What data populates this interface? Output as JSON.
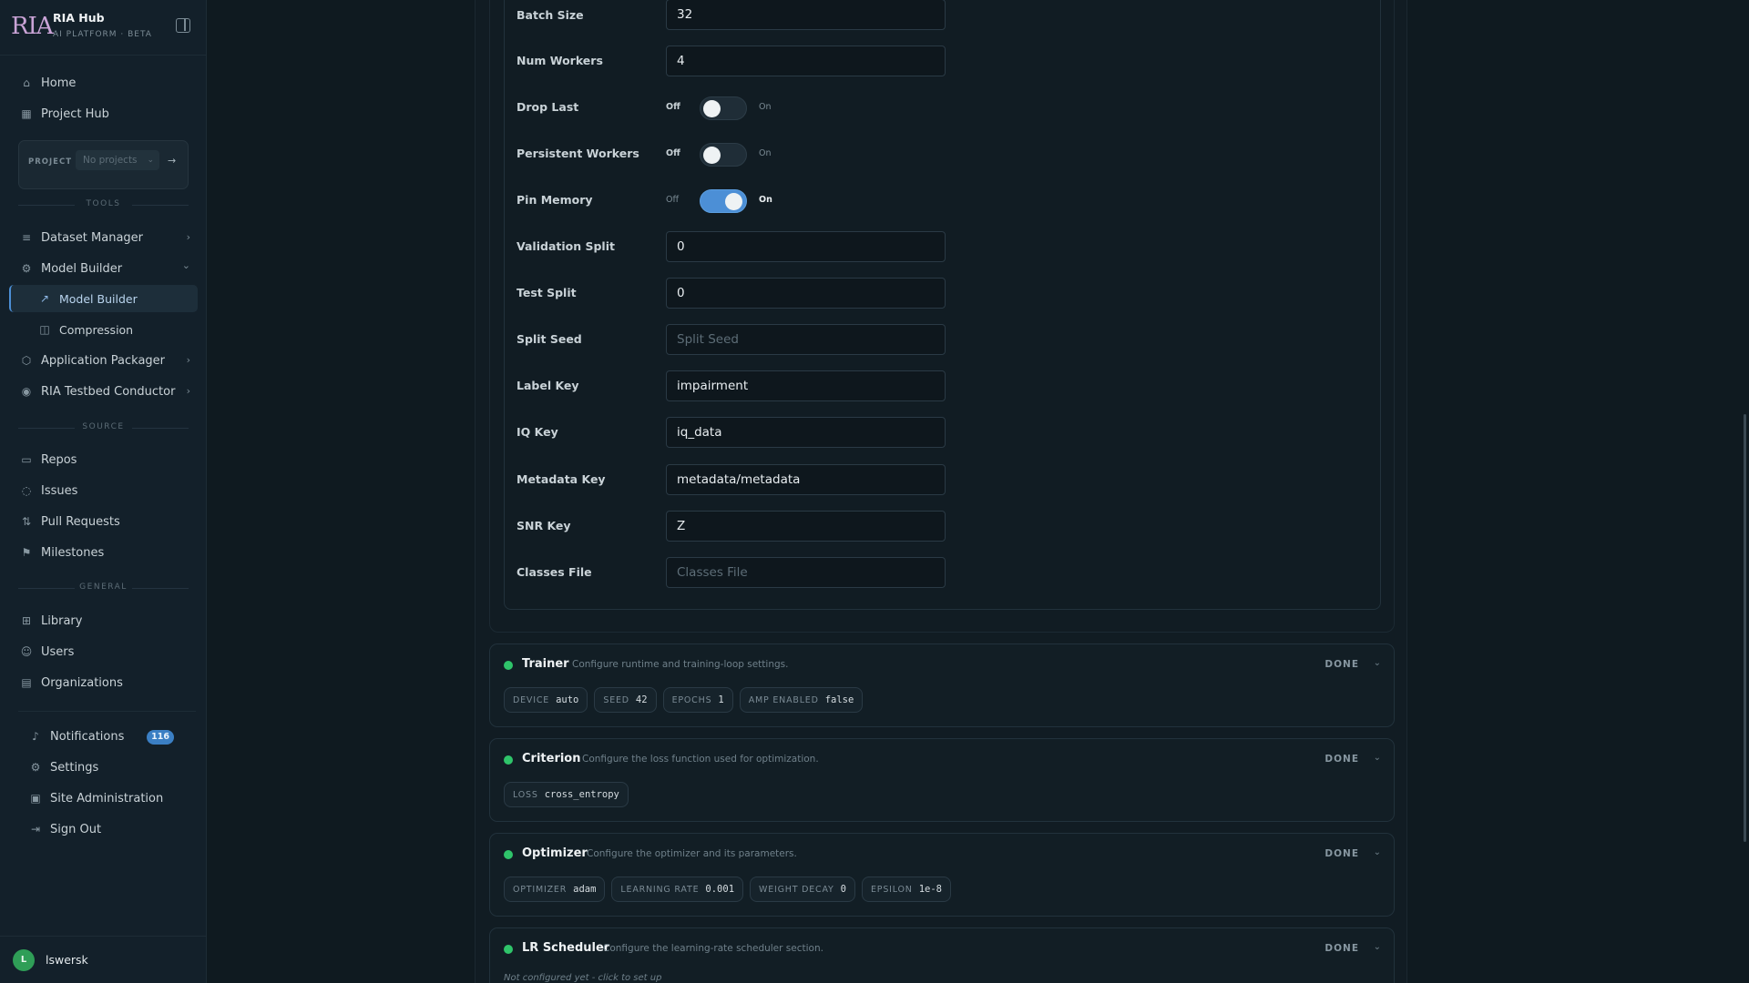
{
  "brand": {
    "logo": "RIA",
    "title": "RIA Hub",
    "subtitle": "AI PLATFORM · BETA"
  },
  "sidebar": {
    "top": [
      {
        "label": "Home",
        "icon": "home-icon"
      },
      {
        "label": "Project Hub",
        "icon": "board-icon"
      }
    ],
    "project": {
      "label": "PROJECT",
      "value": "No projects",
      "go": "→"
    },
    "sections": {
      "tools": "TOOLS",
      "source": "SOURCE",
      "general": "GENERAL"
    },
    "tools": [
      {
        "label": "Dataset Manager",
        "icon": "database-icon",
        "chevron": "›"
      },
      {
        "label": "Model Builder",
        "icon": "gear-icon",
        "chevron": "⌄"
      },
      {
        "label": "Model Builder",
        "icon": "chart-icon",
        "active": true
      },
      {
        "label": "Compression",
        "icon": "compress-icon"
      },
      {
        "label": "Application Packager",
        "icon": "package-icon",
        "chevron": "›"
      },
      {
        "label": "RIA Testbed Conductor",
        "icon": "antenna-icon",
        "chevron": "›"
      }
    ],
    "source": [
      {
        "label": "Repos",
        "icon": "repo-icon"
      },
      {
        "label": "Issues",
        "icon": "issue-icon"
      },
      {
        "label": "Pull Requests",
        "icon": "pull-request-icon"
      },
      {
        "label": "Milestones",
        "icon": "milestone-icon"
      }
    ],
    "general": [
      {
        "label": "Library",
        "icon": "grid-icon"
      },
      {
        "label": "Users",
        "icon": "user-icon"
      },
      {
        "label": "Organizations",
        "icon": "building-icon"
      }
    ],
    "bottom": [
      {
        "label": "Notifications",
        "icon": "bell-icon",
        "badge": "116"
      },
      {
        "label": "Settings",
        "icon": "settings-icon"
      },
      {
        "label": "Site Administration",
        "icon": "admin-icon"
      },
      {
        "label": "Sign Out",
        "icon": "sign-out-icon"
      }
    ],
    "user": {
      "initial": "L",
      "name": "lswersk"
    }
  },
  "form": {
    "batch_size": {
      "label": "Batch Size",
      "value": "32"
    },
    "num_workers": {
      "label": "Num Workers",
      "value": "4"
    },
    "drop_last": {
      "label": "Drop Last",
      "off": "Off",
      "on": "On",
      "state": false
    },
    "persistent_workers": {
      "label": "Persistent Workers",
      "off": "Off",
      "on": "On",
      "state": false
    },
    "pin_memory": {
      "label": "Pin Memory",
      "off": "Off",
      "on": "On",
      "state": true
    },
    "validation_split": {
      "label": "Validation Split",
      "value": "0"
    },
    "test_split": {
      "label": "Test Split",
      "value": "0"
    },
    "split_seed": {
      "label": "Split Seed",
      "value": "",
      "placeholder": "Split Seed"
    },
    "label_key": {
      "label": "Label Key",
      "value": "impairment"
    },
    "iq_key": {
      "label": "IQ Key",
      "value": "iq_data"
    },
    "metadata_key": {
      "label": "Metadata Key",
      "value": "metadata/metadata"
    },
    "snr_key": {
      "label": "SNR Key",
      "value": "Z"
    },
    "classes_file": {
      "label": "Classes File",
      "value": "",
      "placeholder": "Classes File"
    }
  },
  "sections": [
    {
      "title": "Trainer",
      "description": "Configure runtime and training-loop settings.",
      "status": "DONE",
      "chips": [
        {
          "key": "DEVICE",
          "value": "auto"
        },
        {
          "key": "SEED",
          "value": "42"
        },
        {
          "key": "EPOCHS",
          "value": "1"
        },
        {
          "key": "AMP ENABLED",
          "value": "false"
        }
      ]
    },
    {
      "title": "Criterion",
      "description": "Configure the loss function used for optimization.",
      "status": "DONE",
      "chips": [
        {
          "key": "LOSS",
          "value": "cross_entropy"
        }
      ]
    },
    {
      "title": "Optimizer",
      "description": "Configure the optimizer and its parameters.",
      "status": "DONE",
      "chips": [
        {
          "key": "OPTIMIZER",
          "value": "adam"
        },
        {
          "key": "LEARNING RATE",
          "value": "0.001"
        },
        {
          "key": "WEIGHT DECAY",
          "value": "0"
        },
        {
          "key": "EPSILON",
          "value": "1e-8"
        }
      ]
    },
    {
      "title": "LR Scheduler",
      "description": "Configure the learning-rate scheduler section.",
      "status": "DONE",
      "note": "Not configured yet - click to set up"
    }
  ],
  "colors": {
    "accent": "#4c8fd6",
    "done_dot": "#2fc46a",
    "badge": "#3b7fc4"
  }
}
